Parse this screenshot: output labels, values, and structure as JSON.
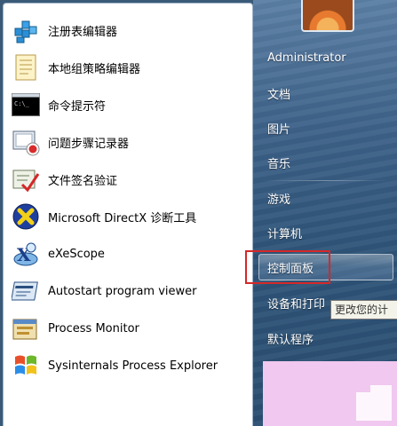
{
  "programs": [
    {
      "label": "注册表编辑器",
      "icon": "registry-editor-icon"
    },
    {
      "label": "本地组策略编辑器",
      "icon": "group-policy-icon"
    },
    {
      "label": "命令提示符",
      "icon": "command-prompt-icon"
    },
    {
      "label": "问题步骤记录器",
      "icon": "steps-recorder-icon"
    },
    {
      "label": "文件签名验证",
      "icon": "signature-verify-icon"
    },
    {
      "label": "Microsoft DirectX 诊断工具",
      "icon": "directx-icon"
    },
    {
      "label": "eXeScope",
      "icon": "exescope-icon"
    },
    {
      "label": "Autostart program viewer",
      "icon": "autostart-viewer-icon"
    },
    {
      "label": "Process Monitor",
      "icon": "process-monitor-icon"
    },
    {
      "label": "Sysinternals Process Explorer",
      "icon": "process-explorer-icon"
    }
  ],
  "right_menu": {
    "user": "Administrator",
    "documents": "文档",
    "pictures": "图片",
    "music": "音乐",
    "games": "游戏",
    "computer": "计算机",
    "control_panel": "控制面板",
    "devices_printers": "设备和打印",
    "default_programs": "默认程序"
  },
  "tooltip": "更改您的计",
  "colors": {
    "highlight_box": "#d42828",
    "right_panel": "#3e6289"
  }
}
